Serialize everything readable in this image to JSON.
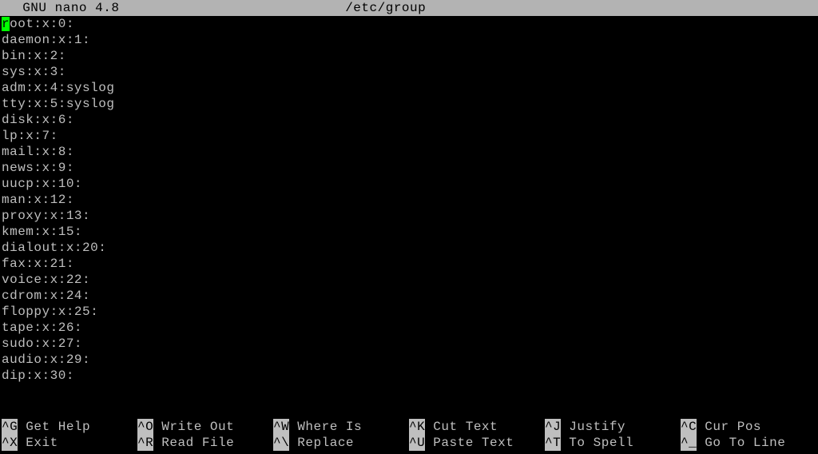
{
  "title": {
    "app": "  GNU nano 4.8",
    "filename": "/etc/group"
  },
  "cursor_char": "r",
  "first_line_rest": "oot:x:0:",
  "lines": [
    "daemon:x:1:",
    "bin:x:2:",
    "sys:x:3:",
    "adm:x:4:syslog",
    "tty:x:5:syslog",
    "disk:x:6:",
    "lp:x:7:",
    "mail:x:8:",
    "news:x:9:",
    "uucp:x:10:",
    "man:x:12:",
    "proxy:x:13:",
    "kmem:x:15:",
    "dialout:x:20:",
    "fax:x:21:",
    "voice:x:22:",
    "cdrom:x:24:",
    "floppy:x:25:",
    "tape:x:26:",
    "sudo:x:27:",
    "audio:x:29:",
    "dip:x:30:"
  ],
  "help": {
    "row1": [
      {
        "key": "^G",
        "label": " Get Help"
      },
      {
        "key": "^O",
        "label": " Write Out"
      },
      {
        "key": "^W",
        "label": " Where Is"
      },
      {
        "key": "^K",
        "label": " Cut Text"
      },
      {
        "key": "^J",
        "label": " Justify"
      },
      {
        "key": "^C",
        "label": " Cur Pos"
      }
    ],
    "row2": [
      {
        "key": "^X",
        "label": " Exit"
      },
      {
        "key": "^R",
        "label": " Read File"
      },
      {
        "key": "^\\",
        "label": " Replace"
      },
      {
        "key": "^U",
        "label": " Paste Text"
      },
      {
        "key": "^T",
        "label": " To Spell"
      },
      {
        "key": "^_",
        "label": " Go To Line"
      }
    ]
  }
}
